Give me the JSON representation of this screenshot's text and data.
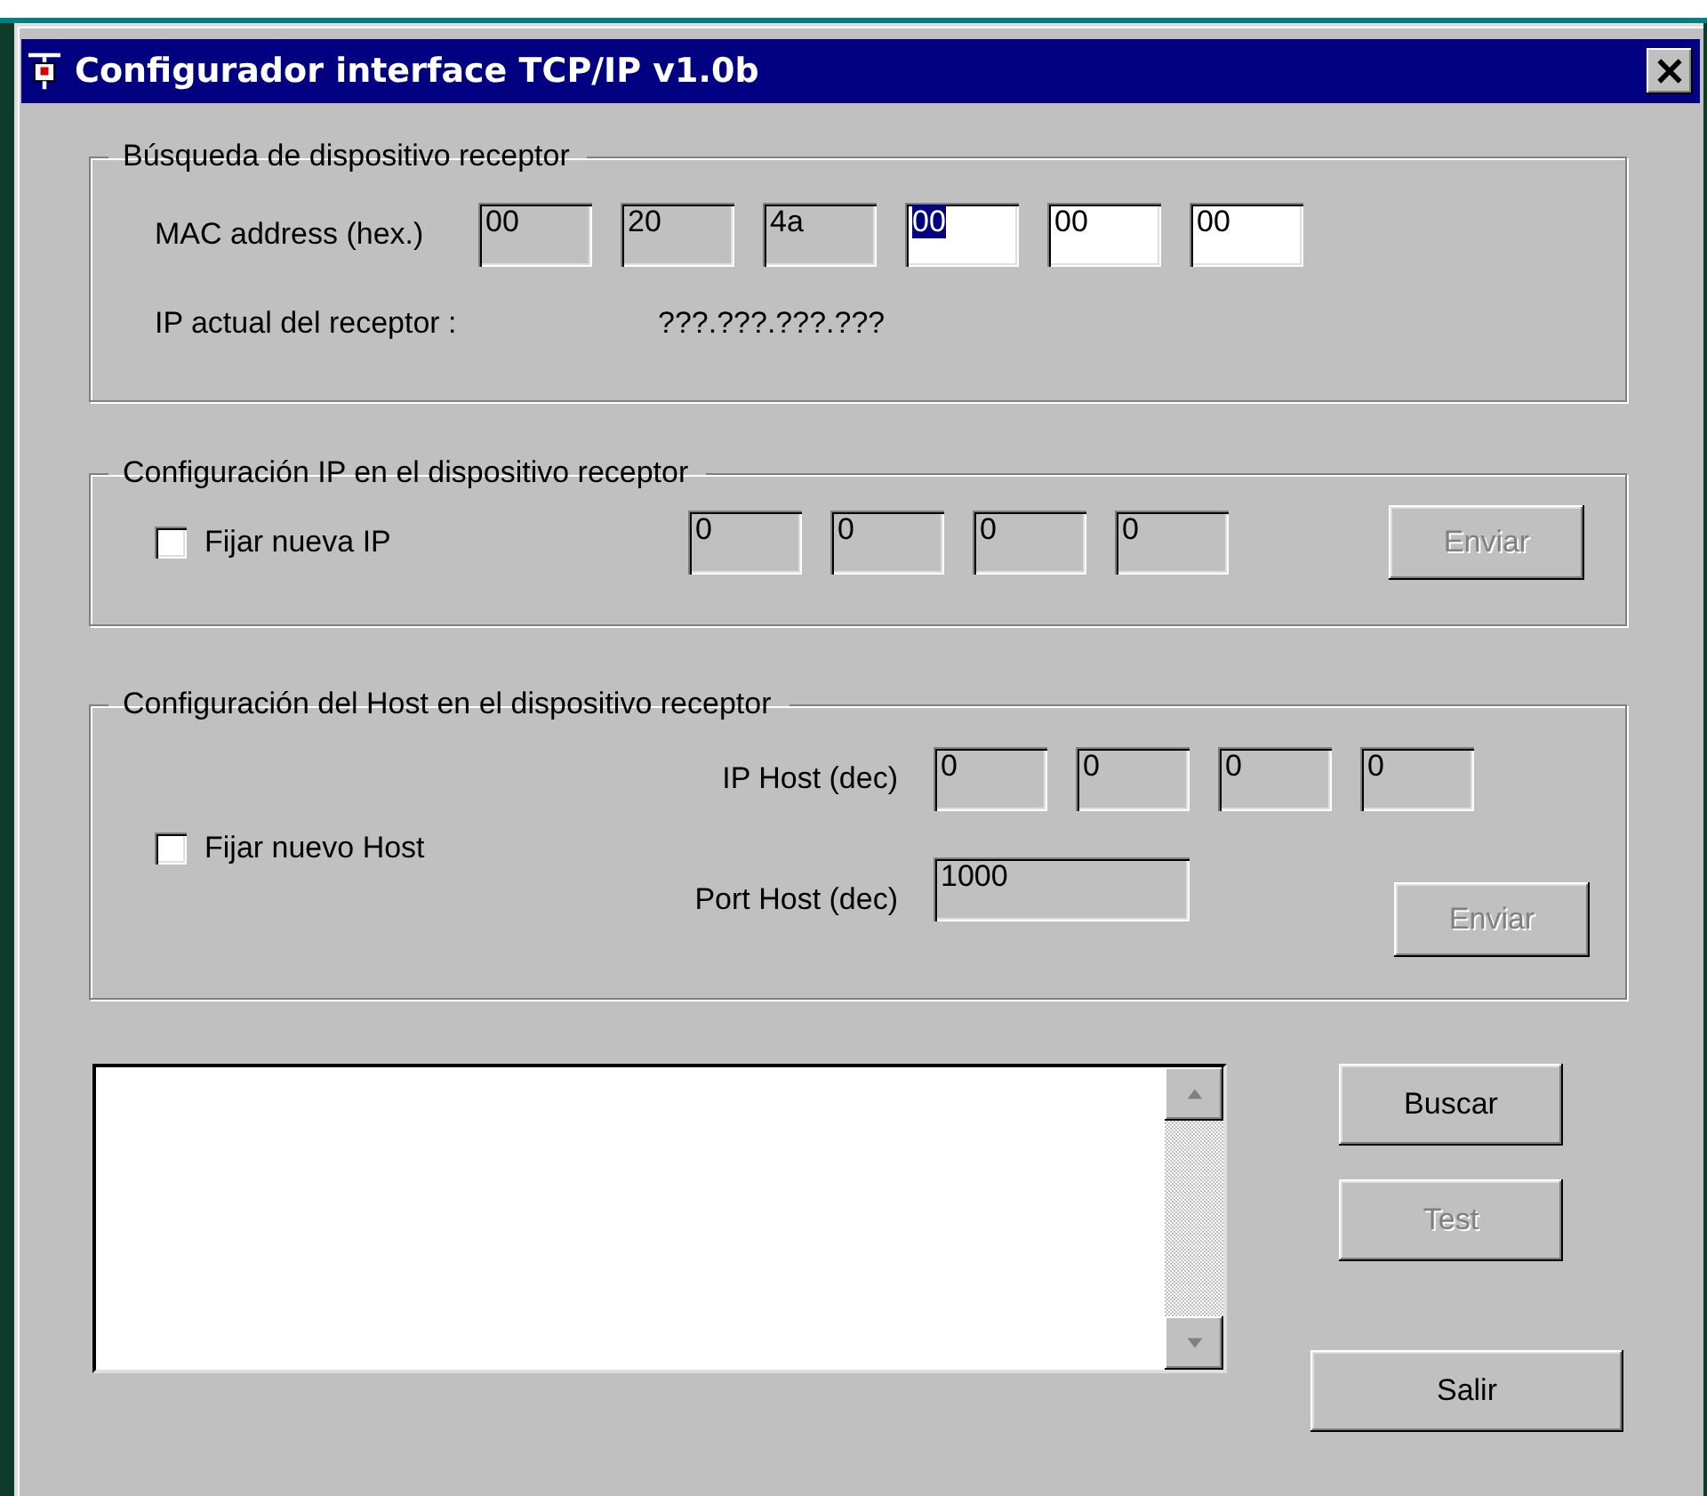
{
  "window": {
    "title": "Configurador interface TCP/IP v1.0b"
  },
  "search_group": {
    "title": "Búsqueda de dispositivo receptor",
    "mac_label": "MAC address (hex.)",
    "mac_fields": [
      {
        "value": "00",
        "disabled": true,
        "selected": false
      },
      {
        "value": "20",
        "disabled": true,
        "selected": false
      },
      {
        "value": "4a",
        "disabled": true,
        "selected": false
      },
      {
        "value": "00",
        "disabled": false,
        "selected": true
      },
      {
        "value": "00",
        "disabled": false,
        "selected": false
      },
      {
        "value": "00",
        "disabled": false,
        "selected": false
      }
    ],
    "ip_label": "IP actual del receptor :",
    "ip_value": "???.???.???.???"
  },
  "ip_group": {
    "title": "Configuración IP en el dispositivo receptor",
    "checkbox": {
      "label": "Fijar nueva IP",
      "checked": false
    },
    "ip_fields": [
      {
        "value": "0",
        "disabled": true
      },
      {
        "value": "0",
        "disabled": true
      },
      {
        "value": "0",
        "disabled": true
      },
      {
        "value": "0",
        "disabled": true
      }
    ],
    "send_button": {
      "label": "Enviar",
      "disabled": true
    }
  },
  "host_group": {
    "title": "Configuración del Host en el dispositivo receptor",
    "checkbox": {
      "label": "Fijar nuevo Host",
      "checked": false
    },
    "ip_label": "IP Host (dec)",
    "ip_fields": [
      {
        "value": "0",
        "disabled": true
      },
      {
        "value": "0",
        "disabled": true
      },
      {
        "value": "0",
        "disabled": true
      },
      {
        "value": "0",
        "disabled": true
      }
    ],
    "port_label": "Port Host (dec)",
    "port_field": {
      "value": "1000",
      "disabled": true
    },
    "send_button": {
      "label": "Enviar",
      "disabled": true
    }
  },
  "buttons": [
    {
      "label": "Buscar",
      "disabled": false
    },
    {
      "label": "Test",
      "disabled": true
    },
    {
      "label": "Salir",
      "disabled": false
    }
  ]
}
